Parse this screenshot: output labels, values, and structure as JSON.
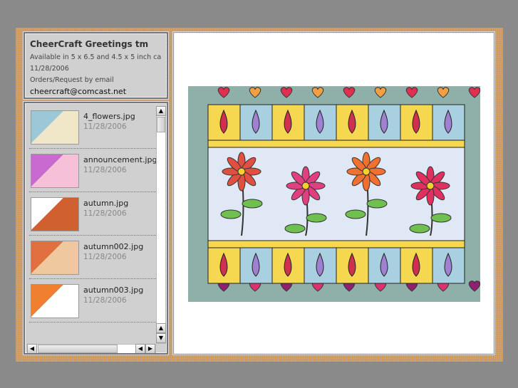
{
  "info": {
    "title": "CheerCraft Greetings tm",
    "subtitle": "Available in 5 x 6.5 and 4.5 x 5 inch cards...",
    "date": "11/28/2006",
    "orders": "Orders/Request by email",
    "email": "cheercraft@comcast.net"
  },
  "list": {
    "items": [
      {
        "name": "4_flowers.jpg",
        "date": "11/28/2006",
        "colors": [
          "#9cc7d6",
          "#f0e6c8"
        ]
      },
      {
        "name": "announcement.jpg",
        "date": "11/28/2006",
        "colors": [
          "#c86ad0",
          "#f5c0d8"
        ]
      },
      {
        "name": "autumn.jpg",
        "date": "11/28/2006",
        "colors": [
          "#ffffff",
          "#d06030"
        ]
      },
      {
        "name": "autumn002.jpg",
        "date": "11/28/2006",
        "colors": [
          "#e07040",
          "#f0c8a0"
        ]
      },
      {
        "name": "autumn003.jpg",
        "date": "11/28/2006",
        "colors": [
          "#f08030",
          "#ffffff"
        ]
      }
    ]
  },
  "scroll": {
    "up": "▲",
    "down": "▼",
    "left": "◀",
    "right": "▶"
  },
  "preview": {
    "selected": "4_flowers.jpg"
  }
}
